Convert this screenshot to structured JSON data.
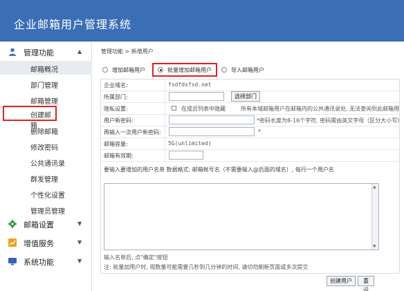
{
  "header": {
    "title": "企业邮箱用户管理系统"
  },
  "sidebar": {
    "groups": [
      {
        "label": "管理功能",
        "icon": "user-icon",
        "chevron": "▲"
      },
      {
        "label": "邮箱设置",
        "icon": "gear-icon",
        "chevron": "▼"
      },
      {
        "label": "增值服务",
        "icon": "chart-icon",
        "chevron": "▼"
      },
      {
        "label": "系统功能",
        "icon": "monitor-icon",
        "chevron": "▼"
      }
    ],
    "items": [
      "邮箱概况",
      "部门管理",
      "邮箱管理",
      "创建邮箱",
      "删除邮箱",
      "修改密码",
      "公共通讯录",
      "群发管理",
      "个性化设置",
      "管理员管理"
    ]
  },
  "breadcrumb": {
    "text": "管理功能 > 新增用户"
  },
  "mode": {
    "options": [
      "增加邮箱用户",
      "批量增加邮箱用户",
      "导入邮箱用户"
    ],
    "selected": "批量增加邮箱用户"
  },
  "form": {
    "domain_label": "企业域名:",
    "domain_value": "fsdfdsfsd.net",
    "dept_label": "所属部门:",
    "dept_button": "选择部门",
    "privacy_label": "隐私设置:",
    "privacy_checkbox": "在成员列表中隐藏",
    "privacy_note": "所有本域邮箱用户在邮箱内的公共通讯录处, 无法查询到此邮箱用户信",
    "pwd_label": "用户新密码:",
    "pwd_hint": "*密码长度为8-16个字符, 密码需由英文字母（区分大小写）、",
    "pwd2_label": "再输入一次用户新密码:",
    "pwd2_hint": "*",
    "quota_label": "邮箱容量:",
    "quota_value": "5G(unlimited)",
    "expiry_label": "邮箱有效期:",
    "names_prompt": "要输入要增加的用户名单 数据格式: 邮箱帐号名（不需要输入@后面的域名）, 每行一个用户名",
    "names_value": ""
  },
  "footer": {
    "hint1": "输入名单后, 点\"确定\"按钮",
    "hint2": "注: 批量加用户时, 视数量可能需要几秒到几分钟的时间, 请切勿刷新页面或多次提交",
    "create_button": "创建用户",
    "reset_button": "重设"
  },
  "colors": {
    "header": "#3b6fb5",
    "highlight": "#e02020"
  }
}
